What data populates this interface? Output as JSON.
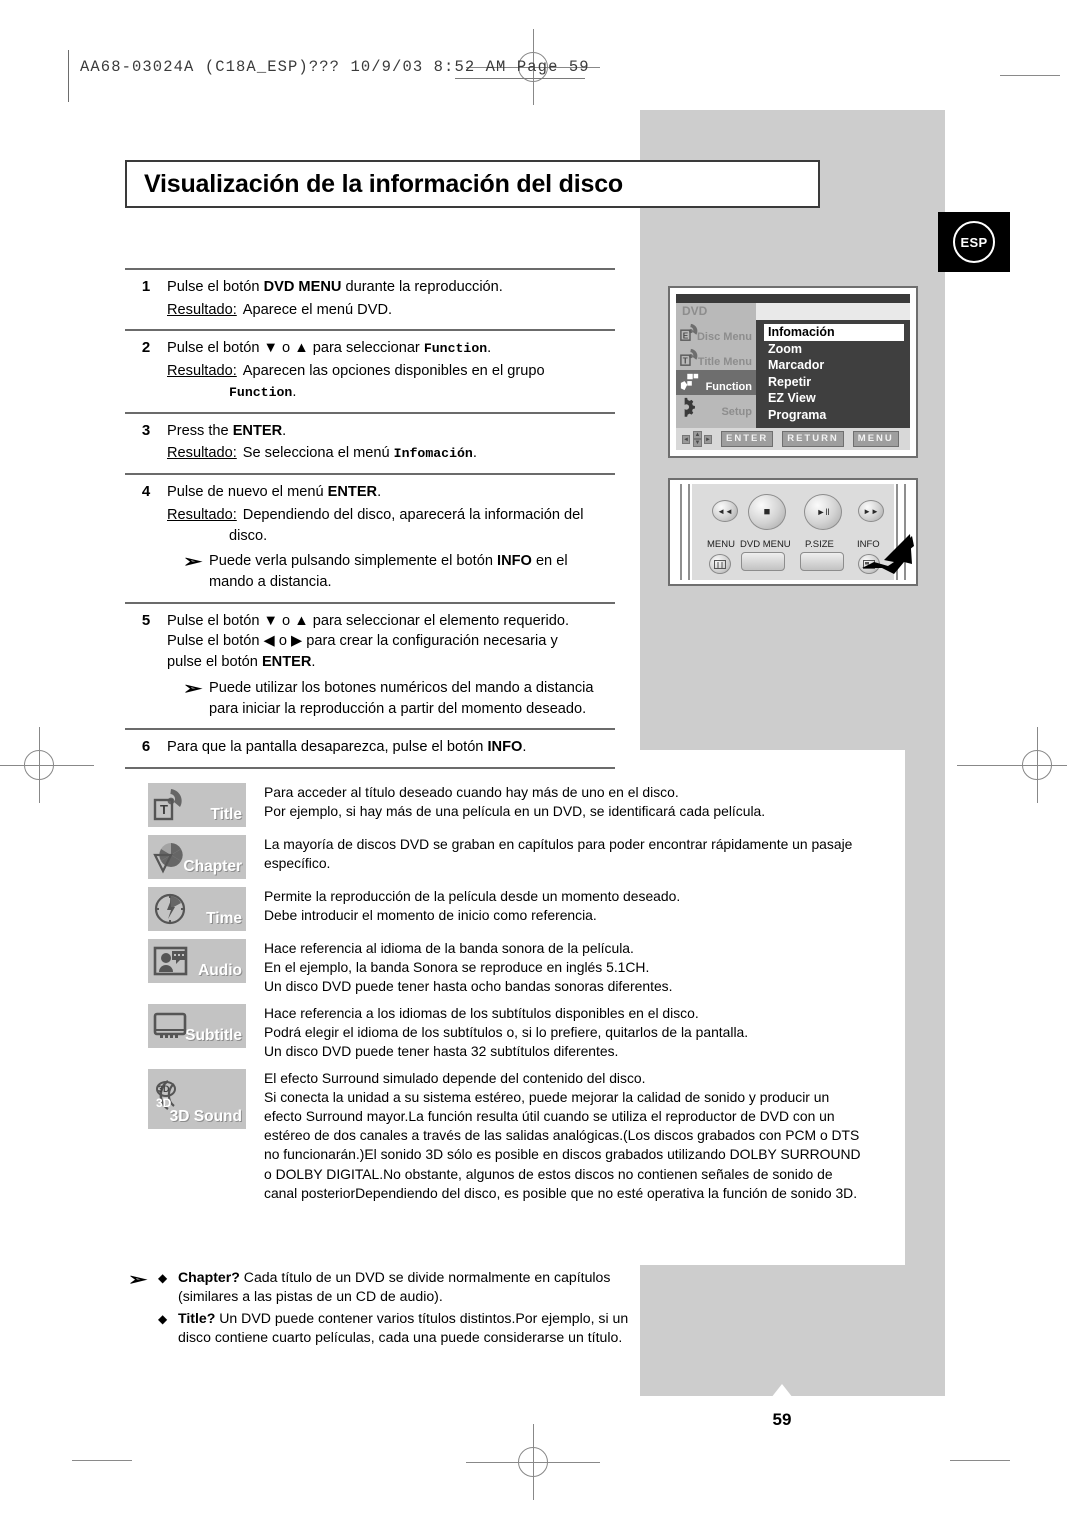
{
  "header": {
    "print_info": "AA68-03024A  (C18A_ESP)???   10/9/03   8:52 AM   Page 59"
  },
  "title": "Visualización de la información del disco",
  "lang_badge": "ESP",
  "page_number": "59",
  "steps": [
    {
      "num": "1",
      "line": "Pulse el botón DVD MENU durante la reproducción.",
      "line_pre": "Pulse el botón ",
      "line_bold": "DVD MENU",
      "line_post": " durante la reproducción.",
      "result_label": "Resultado:",
      "result_text": "Aparece el menú DVD."
    },
    {
      "num": "2",
      "line_pre": "Pulse el botón ▼ o ▲ para seleccionar ",
      "line_mono": "Function",
      "line_post": ".",
      "result_label": "Resultado:",
      "result_text": "Aparecen las opciones disponibles en el grupo",
      "result_mono": "Function",
      "result_mono_post": "."
    },
    {
      "num": "3",
      "line_pre": "Press the ",
      "line_bold": "ENTER",
      "line_post": ".",
      "result_label": "Resultado:",
      "result_text": "Se selecciona el menú ",
      "result_mono": "Infomación",
      "result_mono_post": "."
    },
    {
      "num": "4",
      "line_pre": "Pulse de nuevo el menú ",
      "line_bold": "ENTER",
      "line_post": ".",
      "result_label": "Resultado:",
      "result_text": "Dependiendo del disco, aparecerá la información del",
      "result_text2": "disco.",
      "note_pre": "Puede verla pulsando simplemente el botón ",
      "note_bold": "INFO",
      "note_post": " en el mando a distancia."
    },
    {
      "num": "5",
      "l1": "Pulse el botón ▼ o ▲ para seleccionar el elemento requerido.",
      "l2": "Pulse el botón ◀ o ▶ para crear la configuración necesaria y",
      "l3_pre": "pulse el botón ",
      "l3_bold": "ENTER",
      "l3_post": ".",
      "note": "Puede utilizar los botones numéricos del mando a distancia para iniciar la reproducción a partir del momento deseado."
    },
    {
      "num": "6",
      "line_pre": "Para que la pantalla desaparezca, pulse el botón ",
      "line_bold": "INFO",
      "line_post": "."
    }
  ],
  "osd": {
    "title": "DVD",
    "sidebar": [
      {
        "label": "Disc Menu",
        "active": false,
        "icon": "disc-menu-icon"
      },
      {
        "label": "Title Menu",
        "active": false,
        "icon": "title-menu-icon"
      },
      {
        "label": "Function",
        "active": true,
        "icon": "function-icon"
      },
      {
        "label": "Setup",
        "active": false,
        "icon": "setup-gear-icon"
      }
    ],
    "menu_items": [
      {
        "label": "Infomación",
        "selected": true
      },
      {
        "label": "Zoom",
        "selected": false
      },
      {
        "label": "Marcador",
        "selected": false
      },
      {
        "label": "Repetir",
        "selected": false
      },
      {
        "label": "EZ View",
        "selected": false
      },
      {
        "label": "Programa",
        "selected": false
      }
    ],
    "buttons": [
      "ENTER",
      "RETURN",
      "MENU"
    ]
  },
  "remote": {
    "transport": [
      {
        "icon": "skip-back-icon",
        "glyph": "◄◄"
      },
      {
        "icon": "stop-icon",
        "glyph": "■"
      },
      {
        "icon": "play-pause-icon",
        "glyph": "►ll"
      },
      {
        "icon": "skip-forward-icon",
        "glyph": "►►"
      }
    ],
    "labels": [
      "MENU",
      "DVD MENU",
      "P.SIZE",
      "INFO"
    ]
  },
  "features": [
    {
      "name": "Title",
      "icon": "title-badge-icon",
      "lines": [
        "Para acceder al título deseado cuando hay más de uno en el disco.",
        "Por ejemplo, si hay más de una película en un DVD, se identificará cada película."
      ]
    },
    {
      "name": "Chapter",
      "icon": "chapter-badge-icon",
      "lines": [
        "La mayoría de discos DVD se graban en capítulos para poder encontrar rápidamente un pasaje",
        "específico."
      ]
    },
    {
      "name": "Time",
      "icon": "time-clock-icon",
      "lines": [
        "Permite la reproducción de la película desde un momento deseado.",
        "Debe introducir el momento de inicio como referencia."
      ]
    },
    {
      "name": "Audio",
      "icon": "audio-badge-icon",
      "lines": [
        "Hace referencia al idioma de la banda sonora de la película.",
        "En el ejemplo, la banda Sonora se reproduce en inglés 5.1CH.",
        "Un disco DVD puede tener hasta ocho bandas sonoras diferentes."
      ]
    },
    {
      "name": "Subtitle",
      "icon": "subtitle-badge-icon",
      "lines": [
        "Hace referencia a los idiomas de los subtítulos disponibles en el disco.",
        "Podrá elegir el idioma de los subtítulos o, si lo prefiere, quitarlos de la pantalla.",
        "Un disco DVD puede tener hasta 32 subtítulos diferentes."
      ]
    },
    {
      "name": "3D Sound",
      "icon": "3d-sound-icon",
      "lines": [
        "El efecto Surround simulado depende del contenido del disco.",
        "Si conecta la unidad a su sistema estéreo, puede mejorar la calidad de sonido y producir un",
        "efecto Surround mayor.La función resulta útil cuando se utiliza el reproductor de DVD con un",
        "estéreo de dos canales a través de las salidas analógicas.(Los discos grabados con PCM o DTS",
        "no funcionarán.)El sonido 3D sólo es posible en discos grabados utilizando DOLBY SURROUND",
        "o DOLBY DIGITAL.No obstante, algunos de estos discos no contienen señales de sonido de",
        "canal posteriorDependiendo del disco, es posible que no esté operativa la función de sonido 3D."
      ]
    }
  ],
  "footnotes": [
    {
      "bold": "Chapter?",
      "text": " Cada título de un DVD se divide normalmente en capítulos (similares a las pistas de un CD de audio)."
    },
    {
      "bold": "Title?",
      "text": " Un DVD puede contener varios títulos distintos.Por ejemplo, si un disco contiene cuarto películas, cada una puede considerarse un título."
    }
  ],
  "colors": {
    "gray_panel": "#cdcdcd",
    "badge_gray": "#c3c3c3",
    "osd_dark": "#3f3f3f",
    "rule": "#6b6b6b"
  }
}
